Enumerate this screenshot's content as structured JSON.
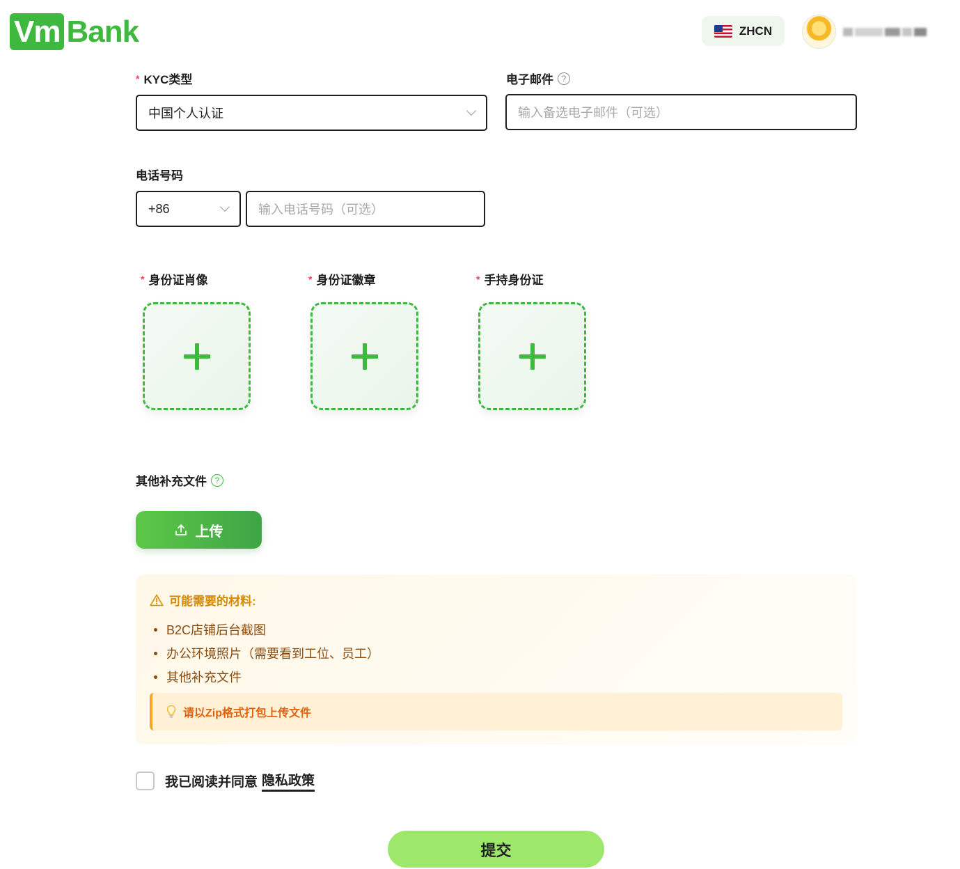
{
  "header": {
    "logo_vm": "Vm",
    "logo_bank": "Bank",
    "language": "ZHCN"
  },
  "form": {
    "kyc_type_label": "KYC类型",
    "kyc_type_value": "中国个人认证",
    "email_label": "电子邮件",
    "email_placeholder": "输入备选电子邮件（可选）",
    "phone_label": "电话号码",
    "phone_code": "+86",
    "phone_placeholder": "输入电话号码（可选）",
    "id_portrait_label": "身份证肖像",
    "id_emblem_label": "身份证徽章",
    "id_handheld_label": "手持身份证",
    "other_docs_label": "其他补充文件",
    "upload_label": "上传"
  },
  "materials": {
    "title": "可能需要的材料:",
    "items": [
      "B2C店铺后台截图",
      "办公环境照片（需要看到工位、员工）",
      "其他补充文件"
    ],
    "tip": "请以Zip格式打包上传文件"
  },
  "agreement": {
    "text": "我已阅读并同意",
    "link": "隐私政策"
  },
  "submit_label": "提交",
  "icons": {
    "help": "question-circle-icon",
    "upload": "upload-icon",
    "warning": "warning-triangle-icon",
    "bulb": "lightbulb-icon",
    "plus": "plus-icon"
  },
  "colors": {
    "brand_green": "#3fb83f",
    "submit_bg": "#9de86b",
    "warning_orange": "#d98a00",
    "tip_text": "#e0620f",
    "required_red": "#e5484d"
  }
}
